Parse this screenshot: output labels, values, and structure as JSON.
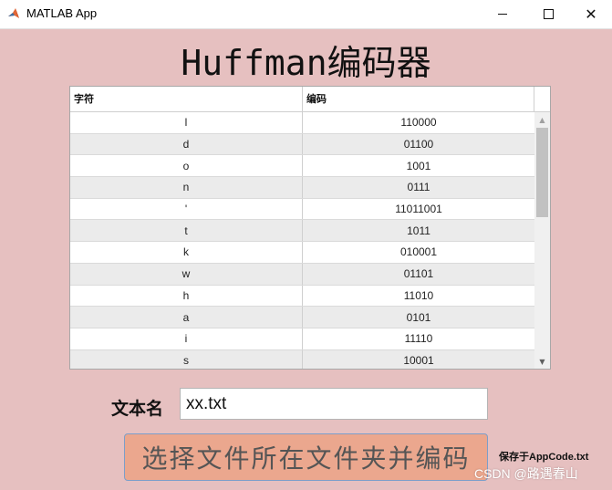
{
  "window": {
    "title": "MATLAB App",
    "controls": {
      "minimize_icon": "minimize-icon",
      "maximize_icon": "maximize-icon",
      "close_icon": "close-icon"
    }
  },
  "main": {
    "title": "Huffman编码器"
  },
  "table": {
    "columns": [
      "字符",
      "编码"
    ],
    "rows": [
      [
        "l",
        "110000"
      ],
      [
        "d",
        "01100"
      ],
      [
        "o",
        "1001"
      ],
      [
        "n",
        "0111"
      ],
      [
        "'",
        "11011001"
      ],
      [
        "t",
        "1011"
      ],
      [
        "k",
        "010001"
      ],
      [
        "w",
        "01101"
      ],
      [
        "h",
        "11010"
      ],
      [
        "a",
        "0101"
      ],
      [
        "i",
        "11110"
      ],
      [
        "s",
        "10001"
      ]
    ]
  },
  "file": {
    "label": "文本名",
    "value": "xx.txt"
  },
  "actions": {
    "encode_button": "选择文件所在文件夹并编码",
    "save_note": "保存于AppCode.txt"
  },
  "watermark": "CSDN @路遇春山",
  "colors": {
    "background": "#e6c0c0",
    "button": "#eba78e",
    "button_border": "#7c9ec9",
    "row_alt": "#ebebeb"
  }
}
